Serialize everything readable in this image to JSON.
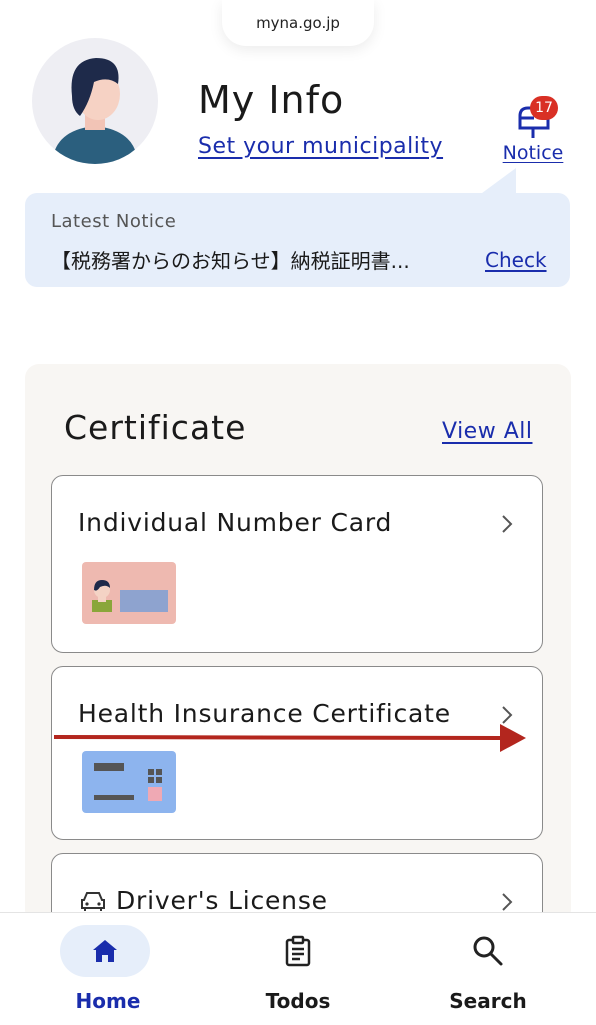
{
  "browser": {
    "url": "myna.go.jp"
  },
  "header": {
    "title": "My Info",
    "municipality_link": "Set your municipality",
    "notice": {
      "label": "Notice",
      "count": "17"
    }
  },
  "latest_notice": {
    "heading": "Latest Notice",
    "text": "【税務署からのお知らせ】納税証明書...",
    "action": "Check"
  },
  "certificate": {
    "title": "Certificate",
    "view_all": "View All",
    "items": [
      {
        "label": "Individual Number Card",
        "icon": "id-card-icon"
      },
      {
        "label": "Health Insurance Certificate",
        "icon": "insurance-card-icon"
      },
      {
        "label": "Driver's License",
        "icon": "car-icon"
      }
    ]
  },
  "bottom_nav": {
    "items": [
      {
        "label": "Home",
        "icon": "home-icon",
        "active": true
      },
      {
        "label": "Todos",
        "icon": "clipboard-icon",
        "active": false
      },
      {
        "label": "Search",
        "icon": "search-icon",
        "active": false
      }
    ]
  },
  "colors": {
    "link": "#1a2dac",
    "badge": "#d93025",
    "notice_bg": "#e6eefa",
    "section_bg": "#f8f6f3",
    "annotation_arrow": "#b3261e"
  }
}
